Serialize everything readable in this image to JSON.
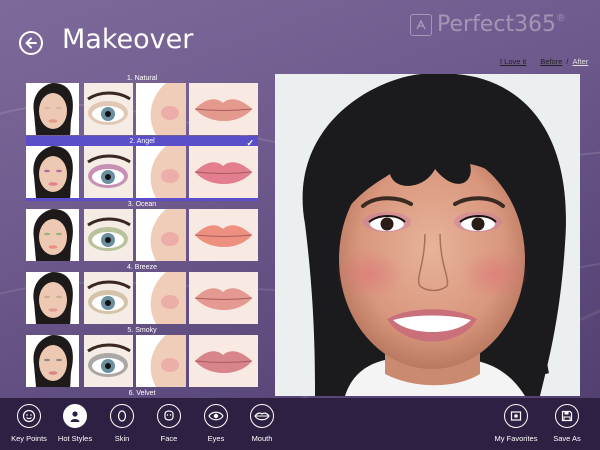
{
  "header": {
    "title": "Makeover",
    "logo_text": "Perfect365",
    "logo_mark": "®"
  },
  "top_links": {
    "love": "I Love it",
    "before": "Before",
    "separator": "/",
    "after": "After"
  },
  "looks": [
    {
      "label": "1. Natural",
      "selected": false
    },
    {
      "label": "2. Angel",
      "selected": true
    },
    {
      "label": "3. Ocean",
      "selected": false
    },
    {
      "label": "4. Breeze",
      "selected": false
    },
    {
      "label": "5. Smoky",
      "selected": false
    },
    {
      "label": "6. Velvet",
      "selected": false
    }
  ],
  "selected_check": "✓",
  "toolbar": {
    "key_points": "Key Points",
    "hot_styles": "Hot Styles",
    "skin": "Skin",
    "face": "Face",
    "eyes": "Eyes",
    "mouth": "Mouth",
    "my_favorites": "My Favorites",
    "save_as": "Save As"
  },
  "icons": {
    "back": "back-arrow-icon",
    "key_points": "smiley-icon",
    "hot_styles": "person-icon",
    "skin": "skin-icon",
    "face": "face-icon",
    "eyes": "eye-icon",
    "mouth": "lips-icon",
    "my_favorites": "favorites-icon",
    "save_as": "save-icon"
  },
  "colors": {
    "background": "#6f5b8d",
    "toolbar": "#2e2042",
    "selection": "#5a4fc9"
  }
}
